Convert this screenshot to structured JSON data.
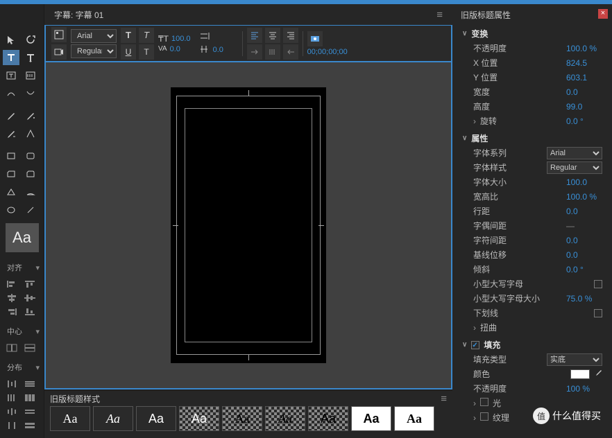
{
  "header": {
    "title": "字幕: 字幕 01"
  },
  "toolbar": {
    "font_family": "Arial",
    "font_style": "Regular",
    "font_size": "100.0",
    "leading": "",
    "kerning": "0.0",
    "timecode": "00;00;00;00"
  },
  "tool_labels": {
    "aa_button": "Aa"
  },
  "align_panel": {
    "title": "对齐"
  },
  "center_panel": {
    "title": "中心"
  },
  "distribute_panel": {
    "title": "分布"
  },
  "styles_panel": {
    "title": "旧版标题样式",
    "items": [
      "Aa",
      "Aa",
      "Aa",
      "Aa",
      "Aa",
      "Aa",
      "Aa",
      "Aa",
      "Aa"
    ]
  },
  "props": {
    "title": "旧版标题属性",
    "groups": {
      "transform": {
        "title": "变换",
        "opacity_label": "不透明度",
        "opacity": "100.0 %",
        "xpos_label": "X 位置",
        "xpos": "824.5",
        "ypos_label": "Y 位置",
        "ypos": "603.1",
        "width_label": "宽度",
        "width": "0.0",
        "height_label": "高度",
        "height": "99.0",
        "rotation_label": "旋转",
        "rotation": "0.0 °"
      },
      "attributes": {
        "title": "属性",
        "font_family_label": "字体系列",
        "font_family": "Arial",
        "font_style_label": "字体样式",
        "font_style": "Regular",
        "font_size_label": "字体大小",
        "font_size": "100.0",
        "aspect_label": "宽高比",
        "aspect": "100.0 %",
        "leading_label": "行距",
        "leading": "0.0",
        "pair_kern_label": "字偶间距",
        "pair_kern": "—",
        "tracking_label": "字符间距",
        "tracking": "0.0",
        "baseline_label": "基线位移",
        "baseline": "0.0",
        "slant_label": "倾斜",
        "slant": "0.0 °",
        "smallcaps_label": "小型大写字母",
        "smallcaps_size_label": "小型大写字母大小",
        "smallcaps_size": "75.0 %",
        "underline_label": "下划线",
        "distort_label": "扭曲"
      },
      "fill": {
        "title": "填充",
        "fill_type_label": "填充类型",
        "fill_type": "实底",
        "color_label": "颜色",
        "opacity_label": "不透明度",
        "opacity": "100 %",
        "sheen_label": "光",
        "texture_label": "纹理"
      }
    }
  },
  "watermark": {
    "badge": "值",
    "text": "什么值得买"
  }
}
